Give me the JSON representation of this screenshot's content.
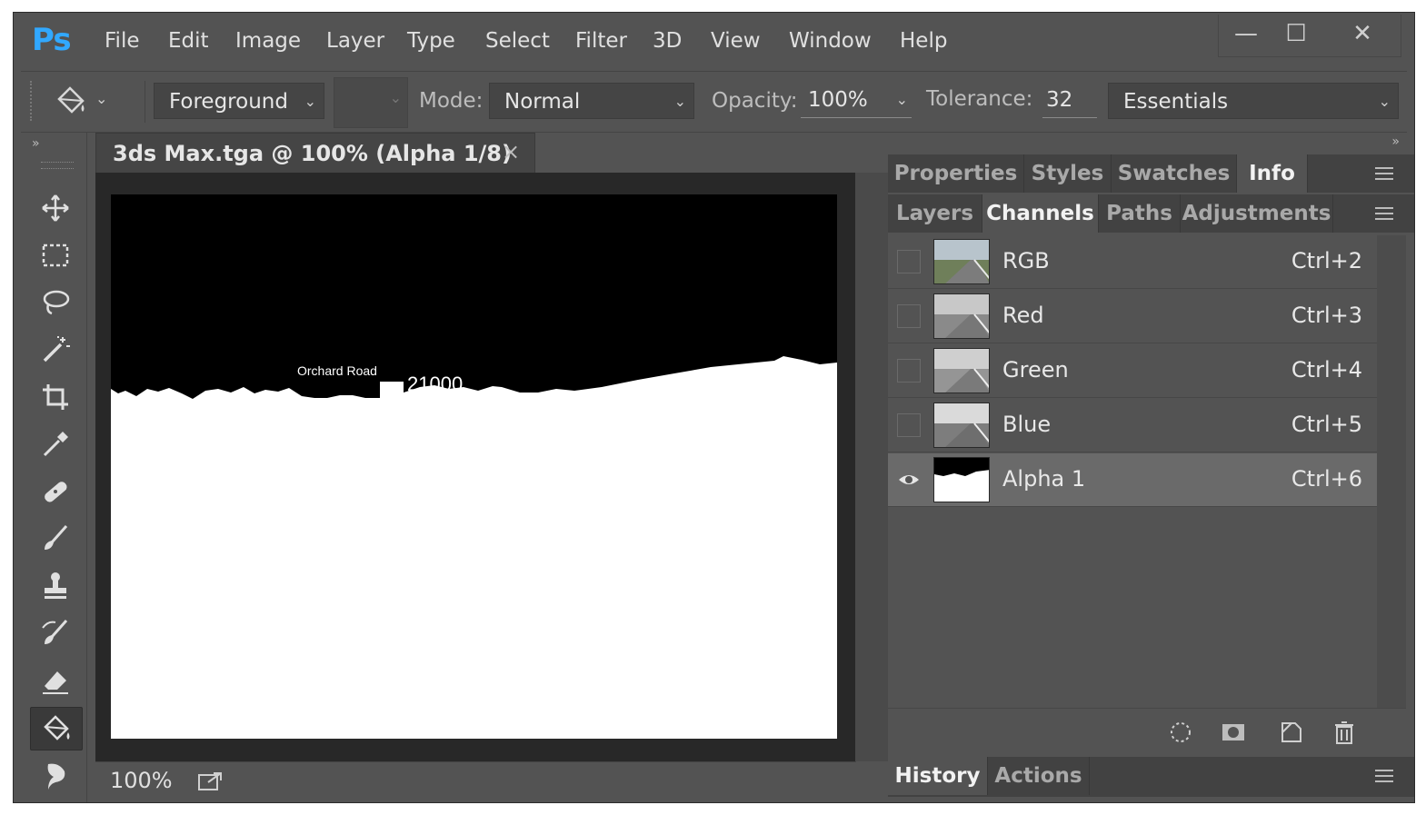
{
  "app": {
    "logo": "Ps"
  },
  "menu": [
    "File",
    "Edit",
    "Image",
    "Layer",
    "Type",
    "Select",
    "Filter",
    "3D",
    "View",
    "Window",
    "Help"
  ],
  "window_controls": {
    "minimize": "—",
    "maximize": "☐",
    "close": "✕"
  },
  "options": {
    "fill_source": "Foreground",
    "mode_label": "Mode:",
    "mode_value": "Normal",
    "opacity_label": "Opacity:",
    "opacity_value": "100%",
    "tolerance_label": "Tolerance:",
    "tolerance_value": "32",
    "workspace": "Essentials"
  },
  "document": {
    "tab_title": "3ds Max.tga @ 100% (Alpha 1/8)",
    "close": "×",
    "zoom": "100%",
    "overlay_text_1": "Orchard Road",
    "overlay_text_2": "21000"
  },
  "panels": {
    "top_tabs": [
      "Properties",
      "Styles",
      "Swatches",
      "Info"
    ],
    "top_active": "Info",
    "second_tabs": [
      "Layers",
      "Channels",
      "Paths",
      "Adjustments"
    ],
    "second_active": "Channels",
    "channels": [
      {
        "name": "RGB",
        "shortcut": "Ctrl+2",
        "visible": false
      },
      {
        "name": "Red",
        "shortcut": "Ctrl+3",
        "visible": false
      },
      {
        "name": "Green",
        "shortcut": "Ctrl+4",
        "visible": false
      },
      {
        "name": "Blue",
        "shortcut": "Ctrl+5",
        "visible": false
      },
      {
        "name": "Alpha 1",
        "shortcut": "Ctrl+6",
        "visible": true,
        "selected": true
      }
    ],
    "bottom_tabs": [
      "History",
      "Actions"
    ],
    "bottom_active": "History"
  },
  "colors": {
    "accent": "#31a8ff",
    "panel": "#535353",
    "dark": "#424242"
  }
}
